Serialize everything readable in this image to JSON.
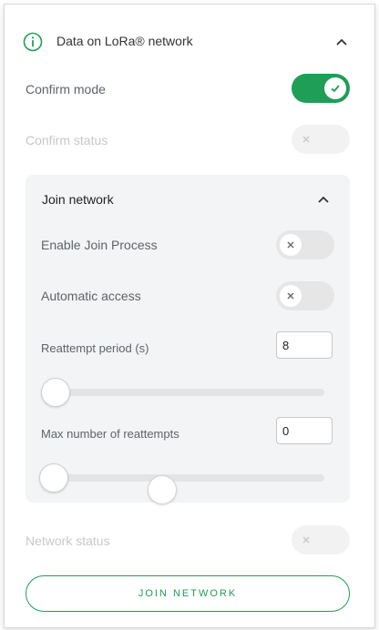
{
  "header": {
    "title": "Data on LoRa® network",
    "icon": "info-icon"
  },
  "confirm_mode": {
    "label": "Confirm mode",
    "state": "on"
  },
  "confirm_status": {
    "label": "Confirm status",
    "state": "disabled"
  },
  "join_panel": {
    "title": "Join network",
    "enable_join": {
      "label": "Enable Join Process",
      "state": "off"
    },
    "auto_access": {
      "label": "Automatic access",
      "state": "off"
    },
    "reattempt_period": {
      "label": "Reattempt period (s)",
      "value": "8"
    },
    "max_reattempts": {
      "label": "Max number of reattempts",
      "value": "0"
    }
  },
  "network_status": {
    "label": "Network status",
    "state": "disabled"
  },
  "join_button": {
    "label": "JOIN NETWORK"
  },
  "colors": {
    "accent": "#1e9e57",
    "panel_bg": "#f3f4f5",
    "disabled_text": "#c8c8c8"
  }
}
